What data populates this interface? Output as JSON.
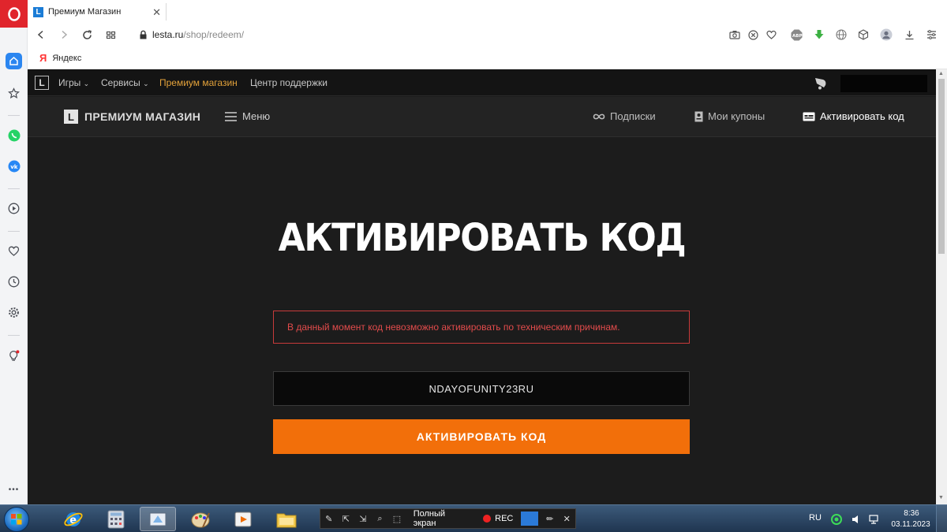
{
  "browser": {
    "tab": {
      "favicon_letter": "L",
      "title": "Премиум Магазин",
      "close_glyph": "✕"
    },
    "address": {
      "host": "lesta.ru",
      "path": "/shop/redeem/"
    },
    "bookmarks": [
      {
        "icon": "Я",
        "label": "Яндекс"
      }
    ],
    "sidebar_more": "•••"
  },
  "site": {
    "top_nav": {
      "logo_letter": "L",
      "items": [
        {
          "label": "Игры",
          "has_dropdown": true
        },
        {
          "label": "Сервисы",
          "has_dropdown": true
        },
        {
          "label": "Премиум магазин",
          "active": true
        },
        {
          "label": "Центр поддержки"
        }
      ]
    },
    "shop_bar": {
      "logo_letter": "L",
      "logo_text": "ПРЕМИУМ МАГАЗИН",
      "menu_label": "Меню",
      "subscriptions": "Подписки",
      "coupons": "Мои купоны",
      "activate": "Активировать код"
    },
    "redeem": {
      "title": "АКТИВИРОВАТЬ КОД",
      "error": "В данный момент код невозможно активировать по техническим причинам.",
      "code_value": "NDAYOFUNITY23RU",
      "button": "АКТИВИРОВАТЬ КОД"
    }
  },
  "taskbar": {
    "recorder": {
      "fullscreen": "Полный экран",
      "rec": "REC",
      "close_glyph": "✕"
    },
    "tray": {
      "lang": "RU",
      "time": "8:36",
      "date": "03.11.2023"
    }
  },
  "colors": {
    "opera_red": "#e0252c",
    "lesta_orange": "#f26f0a",
    "premium_gold": "#e3a23a",
    "error_red": "#e24b4b",
    "page_bg": "#1c1c1c"
  }
}
